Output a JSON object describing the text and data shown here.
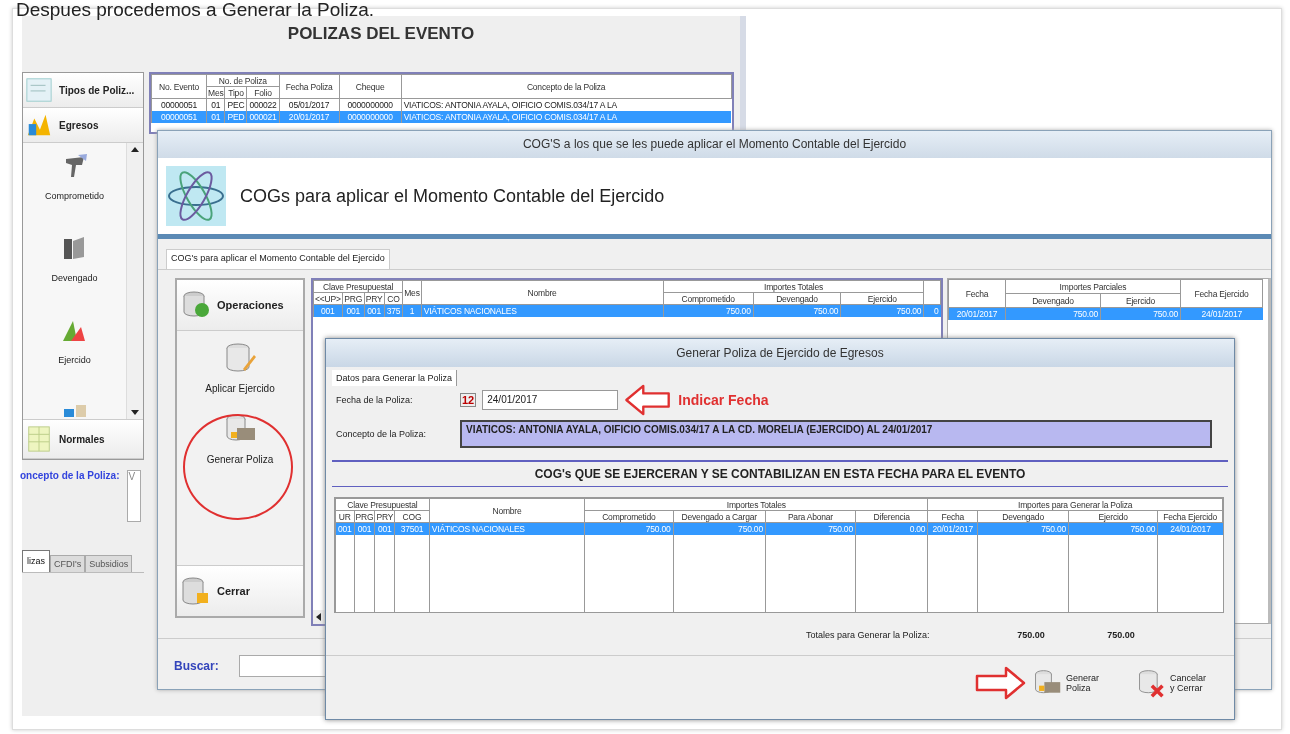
{
  "caption": "Despues procedemos a Generar la Poliza.",
  "polizas_window": {
    "title": "POLIZAS DEL EVENTO",
    "sidebar": {
      "groups": [
        {
          "label": "Tipos de Poliz..."
        },
        {
          "label": "Egresos"
        }
      ],
      "items": [
        {
          "label": "Comprometido"
        },
        {
          "label": "Devengado"
        },
        {
          "label": "Ejercido"
        }
      ],
      "footer": "Normales"
    },
    "table": {
      "columns": [
        {
          "label": "No. Evento"
        },
        {
          "label": "No. de Poliza",
          "colspan": 3,
          "children": [
            {
              "label": "Mes"
            },
            {
              "label": "Tipo"
            },
            {
              "label": "Folio"
            }
          ]
        },
        {
          "label": "Fecha Poliza"
        },
        {
          "label": "Cheque"
        },
        {
          "label": "Concepto de la Poliza"
        }
      ],
      "rows": [
        {
          "selected": false,
          "cells": [
            "00000051",
            "01",
            "PEC",
            "000022",
            "05/01/2017",
            "0000000000",
            "VIATICOS: ANTONIA AYALA, OIFICIO COMIS.034/17 A LA"
          ]
        },
        {
          "selected": true,
          "cells": [
            "00000051",
            "01",
            "PED",
            "000021",
            "20/01/2017",
            "0000000000",
            "VIATICOS: ANTONIA AYALA, OIFICIO COMIS.034/17 A LA"
          ]
        }
      ]
    },
    "concepto_label": "oncepto de la Poliza:",
    "concepto_value": "V",
    "tabs": [
      {
        "label": "lizas",
        "selected": true
      },
      {
        "label": "CFDI's",
        "selected": false
      },
      {
        "label": "Subsidios",
        "selected": false
      }
    ]
  },
  "cogs_window": {
    "title": "COG'S a los que se les puede aplicar el Momento Contable del Ejercido",
    "banner": "COGs para aplicar el Momento Contable del Ejercido",
    "tab": "COG's para aplicar el Momento Contable del Ejercido",
    "operations": {
      "header": "Operaciones",
      "items": [
        {
          "label": "Aplicar Ejercido"
        },
        {
          "label": "Generar Poliza"
        }
      ],
      "footer": "Cerrar"
    },
    "table_left": {
      "columns": [
        {
          "label": "Clave Presupuestal",
          "colspan": 4,
          "children": [
            {
              "label": "<<UP>"
            },
            {
              "label": "PRG"
            },
            {
              "label": "PRY"
            },
            {
              "label": "CO"
            }
          ]
        },
        {
          "label": "Mes"
        },
        {
          "label": "Nombre"
        },
        {
          "label": "Importes Totales",
          "colspan": 3,
          "children": [
            {
              "label": "Comprometido"
            },
            {
              "label": "Devengado"
            },
            {
              "label": "Ejercido"
            }
          ]
        }
      ],
      "rows": [
        {
          "selected": true,
          "cells": [
            "001",
            "001",
            "001",
            "375",
            "1",
            "VIÁTICOS NACIONALES",
            "750.00",
            "750.00",
            "750.00",
            "0"
          ]
        }
      ]
    },
    "table_right": {
      "columns": [
        {
          "label": "Fecha"
        },
        {
          "label": "Importes Parciales",
          "colspan": 2,
          "children": [
            {
              "label": "Devengado"
            },
            {
              "label": "Ejercido"
            }
          ]
        },
        {
          "label": "Fecha Ejercido"
        }
      ],
      "rows": [
        {
          "selected": true,
          "cells": [
            "20/01/2017",
            "750.00",
            "750.00",
            "24/01/2017"
          ]
        }
      ]
    },
    "search_label": "Buscar:"
  },
  "generar_dialog": {
    "title": "Generar Poliza de Ejercido de Egresos",
    "tab": "Datos para Generar la Poliza",
    "fecha_label": "Fecha de la Poliza:",
    "calendar_text": "12",
    "fecha_value": "24/01/2017",
    "concepto_label": "Concepto de la Poliza:",
    "concepto_value": "VIATICOS: ANTONIA AYALA, OIFICIO COMIS.034/17 A LA CD. MORELIA (EJERCIDO) AL 24/01/2017",
    "section_title": "COG's QUE SE EJERCERAN Y SE CONTABILIZAN EN ESTA FECHA PARA EL EVENTO",
    "table": {
      "columns": [
        {
          "label": "Clave Presupuestal",
          "colspan": 4,
          "children": [
            {
              "label": "UR"
            },
            {
              "label": "PRG"
            },
            {
              "label": "PRY"
            },
            {
              "label": "COG"
            }
          ]
        },
        {
          "label": "Nombre"
        },
        {
          "label": "Importes Totales",
          "colspan": 4,
          "children": [
            {
              "label": "Comprometido"
            },
            {
              "label": "Devengado a Cargar"
            },
            {
              "label": "Para Abonar"
            },
            {
              "label": "Diferencia"
            }
          ]
        },
        {
          "label": "Importes para Generar la Poliza",
          "colspan": 4,
          "children": [
            {
              "label": "Fecha"
            },
            {
              "label": "Devengado"
            },
            {
              "label": "Ejercido"
            },
            {
              "label": "Fecha Ejercido"
            }
          ]
        }
      ],
      "rows": [
        {
          "selected": true,
          "cells": [
            "001",
            "001",
            "001",
            "37501",
            "VIÁTICOS NACIONALES",
            "750.00",
            "750.00",
            "750.00",
            "0.00",
            "20/01/2017",
            "750.00",
            "750.00",
            "24/01/2017"
          ]
        }
      ]
    },
    "totals_label": "Totales para Generar la Poliza:",
    "totals": [
      "750.00",
      "750.00"
    ],
    "buttons": [
      {
        "label": "Generar Poliza",
        "kind": "generate"
      },
      {
        "label": "Cancelar y Cerrar",
        "kind": "cancel"
      }
    ]
  },
  "annotation": {
    "text": "Indicar Fecha"
  }
}
